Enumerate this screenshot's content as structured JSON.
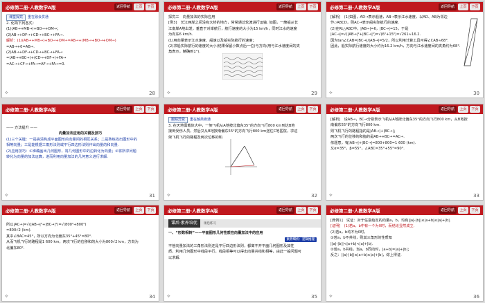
{
  "header": {
    "book_title": "必修第二册·人教数学A版",
    "home_label": "返回导航",
    "prev_label": "上页",
    "next_label": "下页"
  },
  "slides": [
    {
      "page": "28",
      "tag": "课堂探究",
      "tag_sub": "重在融会贯通",
      "lines": [
        "2. 化简下列各式：",
        "(1)(AB→+MB→)+BO→+OM→；",
        "(2)AB→+DF→+CD→+BC→+FA→.",
        "解析：(1)(AB→+MB→)+BO→+OM→=AB→+(MB→+BO→+OM→)",
        "=AB→+0=AB→.",
        "(2)AB→+DF→+CD→+BC→+FA→",
        "=(AB→+BC→)+(CD→+DF→)+FA→",
        "=AC→+CF→+FA→=AF→+FA→=0."
      ]
    },
    {
      "page": "29",
      "title_line": "探究三　向量加法的实际应用",
      "lines": [
        "[例3]　长江两岸之间没有大桥的地方，常常通过轮渡进行运输. 如图，一艘船从长",
        "江南岸A地出发，垂直于对岸航行，航行速度的大小为15 km/h，同时江水的速度",
        "为向东6 km/h.",
        "(1)用向量表示江水速度、船速以及船实际航行的速度；",
        "(2)求船实际航行的速度的大小(结果保留小数点后一位)与方向(用与江水速度间的夹",
        "角表示，精确到1°)."
      ]
    },
    {
      "page": "30",
      "lines": [
        "[解析]　(1)如图，AD→表示船速，AB→表示江水速度，以AD、AB为邻边",
        "作▱ABCD，则AC→表示船实际航行的速度.",
        "(2)在Rt△ABC中，|AB→|=6，|BC→|=15，于是",
        "|AC→|=√(|AB→|²+|BC→|²)=√(6²+15²)=√261≈16.2.",
        "因为tan∠CAB=|BC→|/|AB→|=5/2，所以利用计算工具可得∠CAB≈68°.",
        "因此，船实际航行速度的大小约为16.2 km/h，方向与江水速度间的夹角约为68°."
      ]
    },
    {
      "page": "31",
      "pre": "—— 方法提升 ——",
      "heading": "向量加法应用的关键及技巧",
      "lines": [
        "(1)三个关键：一是搞清构成平面图形的向量间的相互关系；二是熟练找出图形中的",
        "相等向量；三是能根据三角形法则或平行四边形法则作出向量的和向量.",
        "(2)应用技巧：①准确画出几何图形，将几何图形中的边转化为向量；②将所求问题",
        "转化为向量的加法运算，进而利用向量加法的几何意义进行求解."
      ]
    },
    {
      "page": "32",
      "tag": "跟踪异变",
      "tag_sub": "重在触类旁通",
      "lines": [
        "3. 在天地俱载体大中，一架飞机从A地按北偏东35°的方向飞行800 km到达B地",
        "接到受伤人员，然后又从B地按南偏东55°的方向飞行800 km送往C地医院，求这",
        "架飞机飞行的路程及两次位移的和."
      ]
    },
    {
      "page": "33",
      "lines": [
        "[解析]　设AB→，BC→分别表示飞机从A地按北偏东35°的方向飞行800 km，从B地按",
        "南偏东55°的方向飞行800 km.",
        "则飞机飞行的路程指的是|AB→|+|BC→|；",
        "两次飞行的位移的和指的是AB→+BC→=AC→.",
        "依题意，有|AB→|+|BC→|=800+800=1 600 (km).",
        "又α=35°，β=55°，∠ABC=35°+55°=90°."
      ]
    },
    {
      "page": "34",
      "lines": [
        "所以|AC→|=√(|AB→|²+|BC→|²)=√(800²+800²)",
        "=800√2 (km).",
        "其中∠BAC=45°，所以方向为北偏东35°+45°=80°.",
        "从而飞机飞行的路程是1 600 km，两次飞行的位移和的大小为800√2 km，方向为",
        "北偏东80°."
      ]
    },
    {
      "page": "35",
      "section": "课后·素养培优",
      "section_tag": "课后练习",
      "heading": "一、“形数相转”——平面图形几何性质在向量加法中的应用",
      "btn": "素养细析：逻辑推理",
      "lines": [
        "不管向量加法的三角形法则还是平行四边形法则，都离不开平面几何图形及其性",
        "质，利用几何图形中线段平行，线段相等可以得出向量共线和相等，由此一般问题可",
        "以求解."
      ]
    },
    {
      "page": "36",
      "lines": [
        "[典例1]　试证：对于任意给定的向量a，b，均有||a|-|b||≤|a+b|≤|a|+|b|.",
        "[证明]　(1)若a，b中有一个为0时，而结论显然成立.",
        "(2)若a，b均不为0时，",
        "①若a，b不共线，则其三角形的性质知",
        "||a|-|b||<|a+b|<|a|+|b|.",
        "②若a，b共线，当a，b同向时，|a+b|=|a|+|b|；",
        "反之：||a|-|b||≤|a+b|≤|a|+|b|，综上得证."
      ]
    }
  ]
}
